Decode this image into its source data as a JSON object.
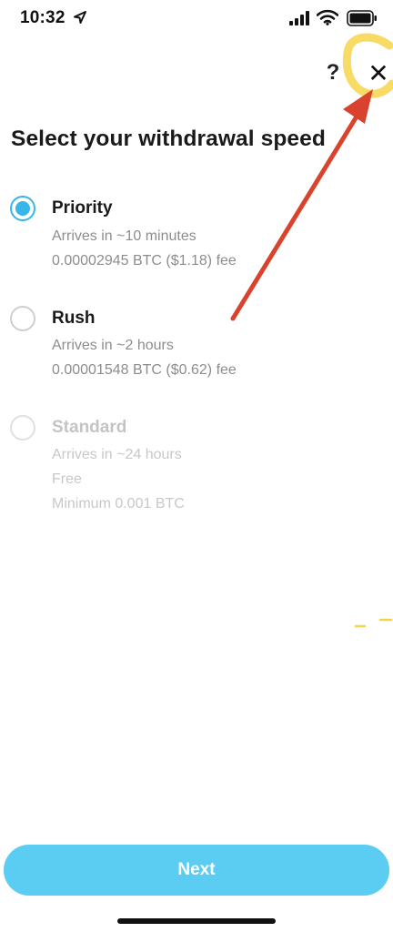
{
  "status_bar": {
    "time": "10:32",
    "icons": [
      "location-arrow",
      "cellular-signal",
      "wifi",
      "battery"
    ]
  },
  "header": {
    "help_label": "?",
    "close_label": "✕"
  },
  "title": "Select your withdrawal speed",
  "options": [
    {
      "name": "Priority",
      "state": "selected",
      "lines": [
        "Arrives in ~10 minutes",
        "0.00002945 BTC ($1.18) fee"
      ]
    },
    {
      "name": "Rush",
      "state": "unselected",
      "lines": [
        "Arrives in ~2 hours",
        "0.00001548 BTC ($0.62) fee"
      ]
    },
    {
      "name": "Standard",
      "state": "disabled",
      "lines": [
        "Arrives in ~24 hours",
        "Free",
        "Minimum 0.001 BTC"
      ]
    }
  ],
  "next_button": {
    "label": "Next"
  },
  "colors": {
    "accent": "#38b6e8",
    "next_button": "#5bcdf2",
    "annotation_arrow": "#d9432d",
    "annotation_highlight": "#f7d54a"
  }
}
